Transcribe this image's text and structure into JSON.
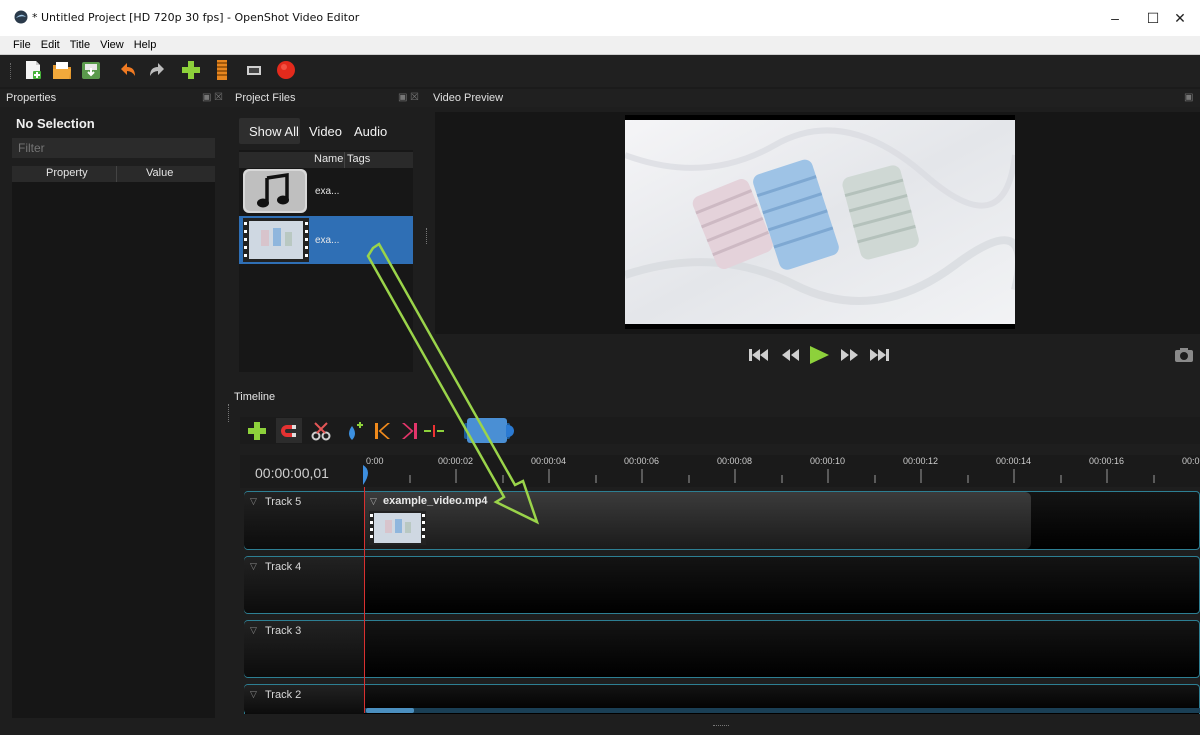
{
  "window": {
    "title": "* Untitled Project [HD 720p 30 fps] - OpenShot Video Editor",
    "minimize": "–",
    "maximize": "☐",
    "close": "✕"
  },
  "menu": [
    "File",
    "Edit",
    "Title",
    "View",
    "Help"
  ],
  "properties": {
    "header": "Properties",
    "selection": "No Selection",
    "filter_placeholder": "Filter",
    "columns": [
      "Property",
      "Value"
    ]
  },
  "project_files": {
    "header": "Project Files",
    "tabs": [
      "Show All",
      "Video",
      "Audio"
    ],
    "columns": [
      "Name",
      "Tags"
    ],
    "files": [
      {
        "name": "exa...",
        "type": "audio"
      },
      {
        "name": "exa...",
        "type": "video",
        "selected": true
      }
    ]
  },
  "video_preview": {
    "header": "Video Preview"
  },
  "timeline": {
    "header": "Timeline",
    "current_time": "00:00:00,01",
    "ticks": [
      "0:00",
      "00:00:02",
      "00:00:04",
      "00:00:06",
      "00:00:08",
      "00:00:10",
      "00:00:12",
      "00:00:14",
      "00:00:16",
      "00:0"
    ],
    "tracks": [
      "Track 5",
      "Track 4",
      "Track 3",
      "Track 2"
    ],
    "clip": {
      "name": "example_video.mp4"
    }
  },
  "colors": {
    "accent_green": "#8dd13b",
    "selection_blue": "#2f6fb5",
    "track_border": "#2d7f93",
    "playhead": "#d93030"
  }
}
